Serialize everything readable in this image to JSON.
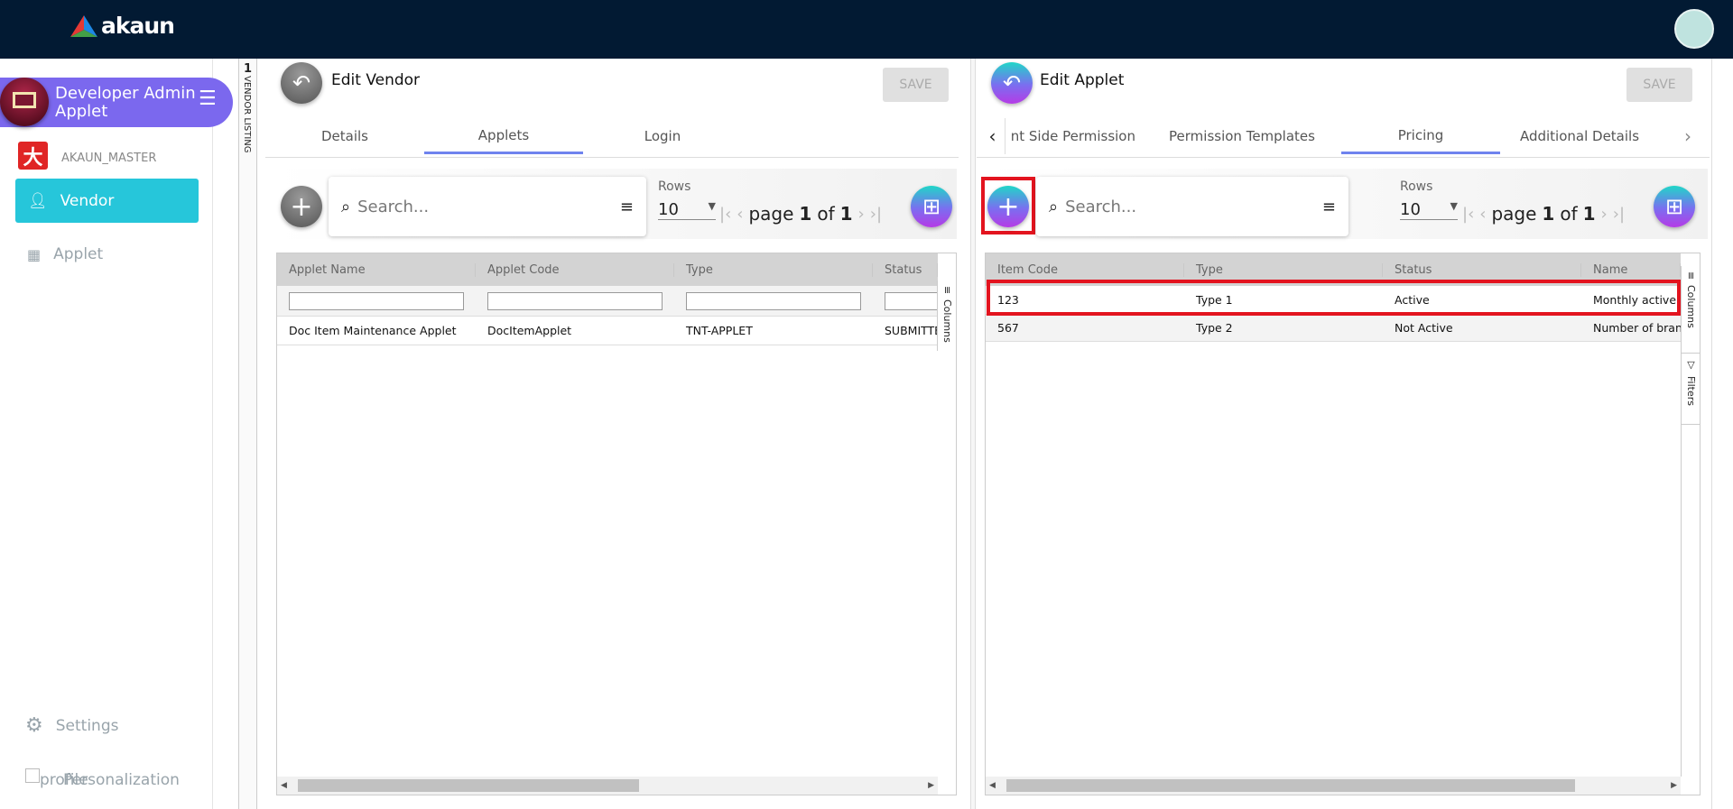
{
  "header": {
    "logo_text": "akaun",
    "brand_colors": {
      "topbar": "#021a33",
      "accent": "#7b68ee",
      "active": "#26c6da",
      "highlight": "#e3141f"
    }
  },
  "sidebar": {
    "app_title": "Developer Admin Applet",
    "org": "AKAUN_MASTER",
    "items": [
      {
        "label": "Vendor",
        "icon": "person-icon",
        "active": true
      },
      {
        "label": "Applet",
        "icon": "grid-icon",
        "active": false
      }
    ],
    "settings": "Settings",
    "personalization": "Personalization",
    "profile": "profile"
  },
  "breadcrumb_strip": {
    "count": "1",
    "label": "VENDOR LISTING"
  },
  "left_panel": {
    "title": "Edit Vendor",
    "save": "SAVE",
    "tabs": [
      "Details",
      "Applets",
      "Login"
    ],
    "active_tab": "Applets",
    "search_placeholder": "Search...",
    "rows_label": "Rows",
    "rows_value": "10",
    "page_word": "page",
    "page": "1",
    "of_word": "of",
    "total_pages": "1",
    "columns": [
      "Applet Name",
      "Applet Code",
      "Type",
      "Status"
    ],
    "rows": [
      [
        "Doc Item Maintenance Applet",
        "DocItemApplet",
        "TNT-APPLET",
        "SUBMITTED"
      ]
    ],
    "side_tabs": [
      "Columns"
    ]
  },
  "right_panel": {
    "title": "Edit Applet",
    "save": "SAVE",
    "tabs": [
      "nt Side Permission",
      "Permission Templates",
      "Pricing",
      "Additional Details"
    ],
    "active_tab": "Pricing",
    "search_placeholder": "Search...",
    "rows_label": "Rows",
    "rows_value": "10",
    "page_word": "page",
    "page": "1",
    "of_word": "of",
    "total_pages": "1",
    "columns": [
      "Item Code",
      "Type",
      "Status",
      "Name"
    ],
    "rows": [
      [
        "123",
        "Type 1",
        "Active",
        "Monthly active u"
      ],
      [
        "567",
        "Type 2",
        "Not Active",
        "Number of bran"
      ]
    ],
    "side_tabs": [
      "Columns",
      "Filters"
    ]
  }
}
